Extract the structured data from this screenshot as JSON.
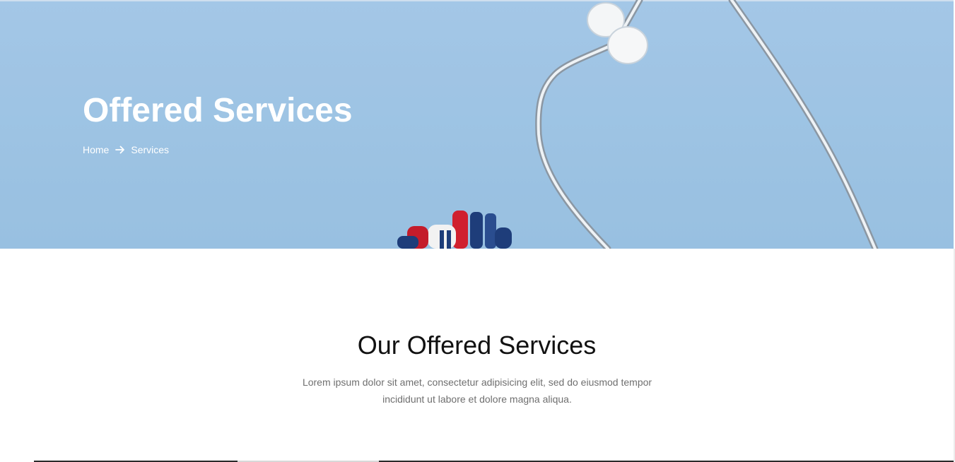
{
  "hero": {
    "title": "Offered Services",
    "breadcrumb": {
      "home_label": "Home",
      "separator_icon": "arrow-right-icon",
      "current_label": "Services"
    },
    "background_color": "#9fc4e4"
  },
  "section": {
    "title": "Our Offered Services",
    "description": "Lorem ipsum dolor sit amet, consectetur adipisicing elit, sed do eiusmod tempor incididunt ut labore et dolore magna aliqua."
  },
  "colors": {
    "hero_text": "#ffffff",
    "heading": "#111111",
    "body_text": "#6f6f6f"
  }
}
